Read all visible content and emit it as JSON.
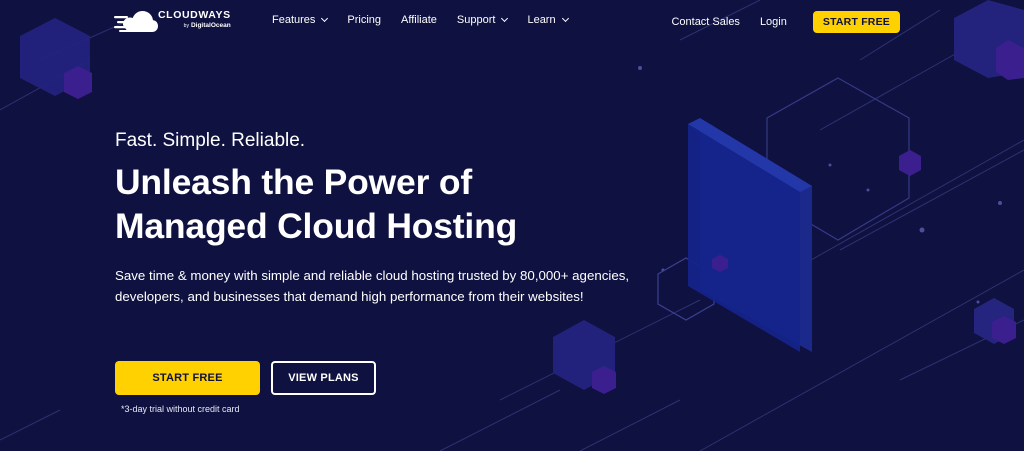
{
  "nav": {
    "logo": {
      "name": "CLOUDWAYS",
      "by": "by",
      "sub": "DigitalOcean"
    },
    "links": [
      {
        "label": "Features",
        "dropdown": true
      },
      {
        "label": "Pricing",
        "dropdown": false
      },
      {
        "label": "Affiliate",
        "dropdown": false
      },
      {
        "label": "Support",
        "dropdown": true
      },
      {
        "label": "Learn",
        "dropdown": true
      }
    ],
    "contact_sales": "Contact Sales",
    "login": "Login",
    "start_free": "START FREE"
  },
  "hero": {
    "tagline": "Fast. Simple. Reliable.",
    "headline_line1": "Unleash the Power of",
    "headline_line2": "Managed Cloud Hosting",
    "description": "Save time & money with simple and reliable cloud hosting trusted by 80,000+ agencies, developers, and businesses that demand high performance from their websites!",
    "primary_cta": "START FREE",
    "secondary_cta": "VIEW PLANS",
    "trial_note": "*3-day trial without credit card"
  },
  "colors": {
    "background": "#0f1140",
    "accent": "#ffd100",
    "hexagon": "#2a2a8c",
    "hexagon_dark": "#3a1a8a"
  }
}
